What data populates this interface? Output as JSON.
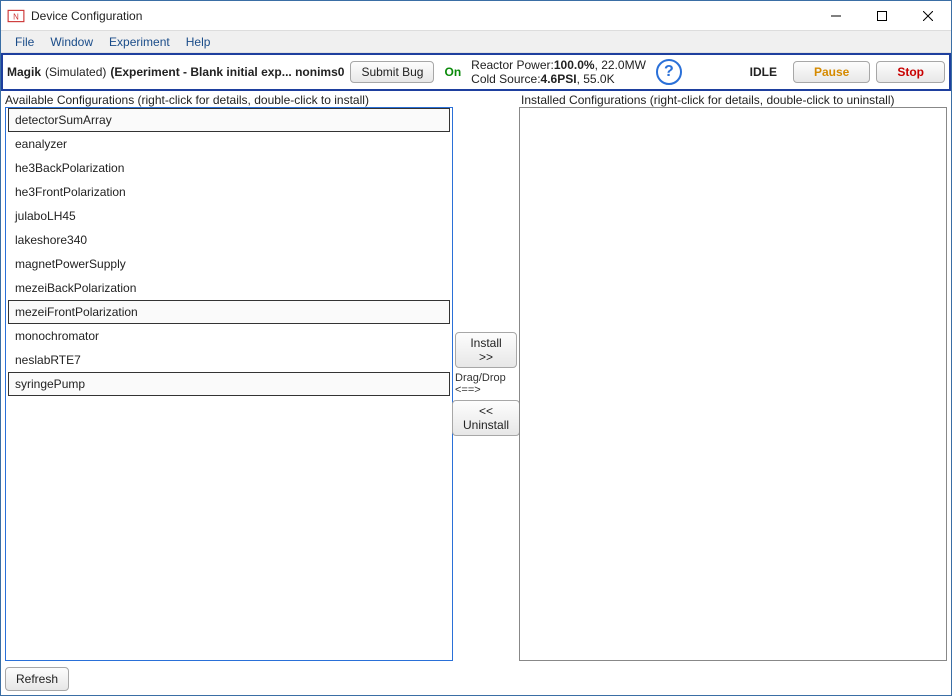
{
  "window": {
    "title": "Device Configuration",
    "icon_label": "app-icon"
  },
  "menubar": {
    "items": [
      "File",
      "Window",
      "Experiment",
      "Help"
    ]
  },
  "toolbar": {
    "instrument_name": "Magik",
    "instrument_mode": " (Simulated)",
    "experiment_label": "  (Experiment - Blank initial exp... nonims0",
    "submit_bug": "Submit Bug",
    "on_label": "On",
    "reactor_line1_label": "Reactor Power:",
    "reactor_line1_value": "100.0%",
    "reactor_line1_suffix": ", 22.0MW",
    "reactor_line2_label": "Cold Source:",
    "reactor_line2_value": "4.6PSI",
    "reactor_line2_suffix": ", 55.0K",
    "idle": "IDLE",
    "pause": "Pause",
    "stop": "Stop"
  },
  "labels": {
    "available": "Available Configurations (right-click for details, double-click to install)",
    "installed": "Installed Configurations (right-click for details, double-click to uninstall)"
  },
  "buttons": {
    "install": "Install >>",
    "dragdrop": "Drag/Drop <==>",
    "uninstall": "<< Uninstall",
    "refresh": "Refresh"
  },
  "available_configs": [
    {
      "name": "detectorSumArray",
      "selected": true
    },
    {
      "name": "eanalyzer",
      "selected": false
    },
    {
      "name": "he3BackPolarization",
      "selected": false
    },
    {
      "name": "he3FrontPolarization",
      "selected": false
    },
    {
      "name": "julaboLH45",
      "selected": false
    },
    {
      "name": "lakeshore340",
      "selected": false
    },
    {
      "name": "magnetPowerSupply",
      "selected": false
    },
    {
      "name": "mezeiBackPolarization",
      "selected": false
    },
    {
      "name": "mezeiFrontPolarization",
      "selected": true
    },
    {
      "name": "monochromator",
      "selected": false
    },
    {
      "name": "neslabRTE7",
      "selected": false
    },
    {
      "name": "syringePump",
      "selected": true
    }
  ],
  "installed_configs": []
}
